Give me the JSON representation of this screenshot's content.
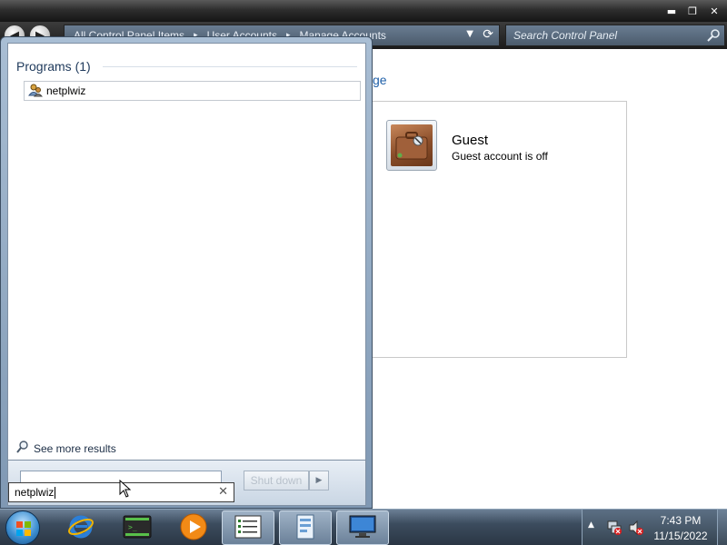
{
  "window": {
    "breadcrumbs": [
      "All Control Panel Items",
      "User Accounts",
      "Manage Accounts"
    ],
    "search_placeholder": "Search Control Panel",
    "heading_fragment": "ge"
  },
  "accounts": [
    {
      "name": "Guest",
      "status": "Guest account is off"
    }
  ],
  "start_menu": {
    "group_title": "Programs (1)",
    "results": [
      {
        "label": "netplwiz",
        "icon": "user-accounts-icon"
      }
    ],
    "see_more_label": "See more results",
    "shutdown_label": "Shut down",
    "search_value": "netplwiz"
  },
  "taskbar": {
    "pinned": [
      {
        "name": "internet-explorer",
        "icon": "internet-explorer-icon"
      },
      {
        "name": "command-prompt",
        "icon": "terminal-icon"
      },
      {
        "name": "media-player",
        "icon": "media-player-icon"
      },
      {
        "name": "task-list",
        "icon": "list-window-icon"
      },
      {
        "name": "control-panel",
        "icon": "control-panel-icon"
      },
      {
        "name": "remote-desktop",
        "icon": "monitor-icon"
      }
    ],
    "clock": {
      "time": "7:43 PM",
      "date": "11/15/2022"
    }
  },
  "colors": {
    "link": "#1e5fa8",
    "titlebar": "#2e2e2e",
    "taskbar": "#3c4c5e"
  }
}
